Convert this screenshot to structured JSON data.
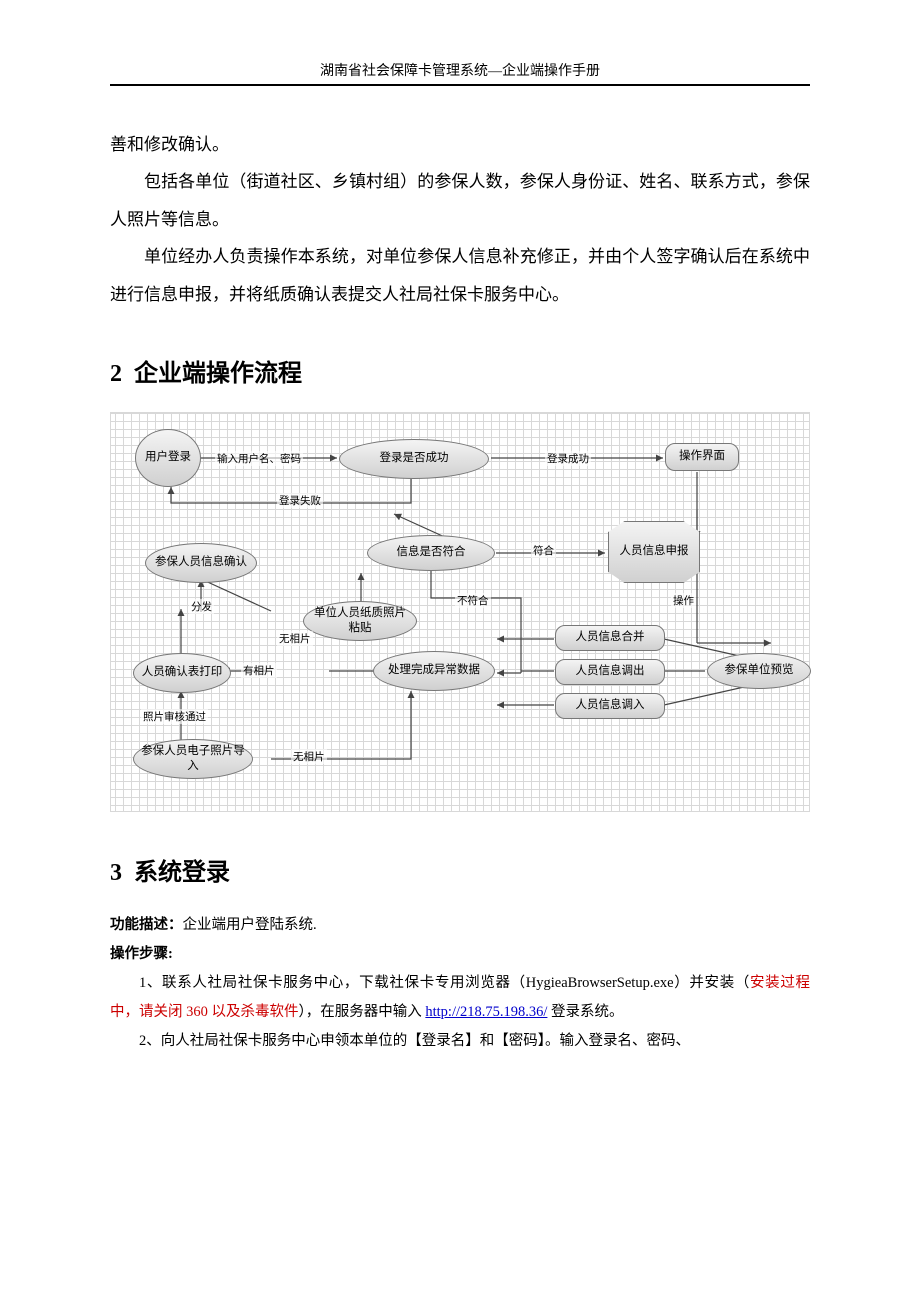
{
  "doc": {
    "header": "湖南省社会保障卡管理系统—企业端操作手册",
    "para0": "善和修改确认。",
    "para1": "包括各单位（街道社区、乡镇村组）的参保人数，参保人身份证、姓名、联系方式，参保人照片等信息。",
    "para2": "单位经办人负责操作本系统，对单位参保人信息补充修正，并由个人签字确认后在系统中进行信息申报，并将纸质确认表提交人社局社保卡服务中心。",
    "sec2num": "2",
    "sec2title": "企业端操作流程",
    "sec3num": "3",
    "sec3title": "系统登录",
    "funcLabel": "功能描述：",
    "funcText": "企业端用户登陆系统.",
    "stepLabel": "操作步骤:",
    "step1a": "1、联系人社局社保卡服务中心，下载社保卡专用浏览器（HygieaBrowserSetup.exe）并安装（",
    "step1red": "安装过程中，请关闭 360 以及杀毒软件",
    "step1b": "），在服务器中输入 ",
    "step1url": "http://218.75.198.36/",
    "step1c": " 登录系统。",
    "step2": "2、向人社局社保卡服务中心申领本单位的【登录名】和【密码】。输入登录名、密码、"
  },
  "flow": {
    "n1": "用户登录",
    "n2": "登录是否成功",
    "n3": "操作界面",
    "n4": "信息是否符合",
    "n5": "人员信息申报",
    "n6": "参保人员信息确认",
    "n7": "单位人员纸质照片粘贴",
    "n8": "人员确认表打印",
    "n9": "处理完成异常数据",
    "n10": "人员信息合并",
    "n11": "人员信息调出",
    "n12": "人员信息调入",
    "n13": "参保单位预览",
    "n14": "参保人员电子照片导入",
    "e1": "输入用户名、密码",
    "e2": "登录成功",
    "e3": "登录失败",
    "e4": "符合",
    "e5": "操作",
    "e6": "不符合",
    "e7": "分发",
    "e8": "无相片",
    "e9": "有相片",
    "e10": "照片审核通过",
    "e11": "无相片"
  }
}
